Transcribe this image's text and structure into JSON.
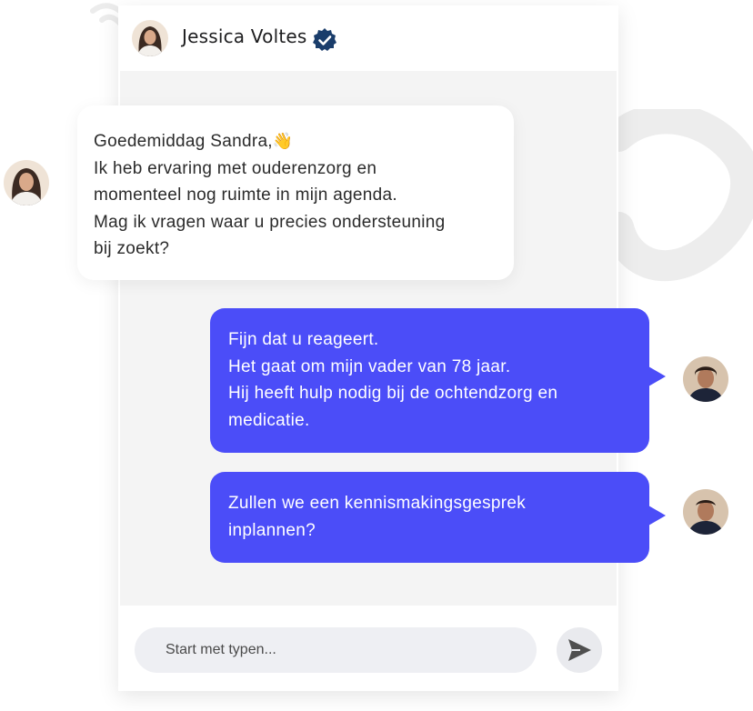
{
  "contact": {
    "name": "Jessica Voltes",
    "avatar_icon": "woman-avatar",
    "verified_icon": "verified-badge-icon"
  },
  "messages": [
    {
      "direction": "incoming",
      "lines": [
        "Goedemiddag Sandra,",
        "Ik heb ervaring met ouderenzorg en",
        "momenteel nog ruimte in mijn agenda.",
        "Mag ik vragen waar u precies ondersteuning",
        "bij zoekt?"
      ],
      "emoji": "👋"
    },
    {
      "direction": "outgoing",
      "lines": [
        "Fijn dat u reageert.",
        "Het gaat om mijn vader van 78 jaar.",
        "Hij heeft hulp nodig bij de ochtendzorg en",
        "medicatie."
      ]
    },
    {
      "direction": "outgoing",
      "lines": [
        "Zullen we een kennismakingsgesprek",
        "inplannen?"
      ]
    }
  ],
  "composer": {
    "placeholder": "Start met typen...",
    "send_icon": "send-icon"
  },
  "colors": {
    "outgoing_bubble": "#4b4df8",
    "verified_badge": "#1a3d6b",
    "chat_background": "#f4f4f4"
  }
}
